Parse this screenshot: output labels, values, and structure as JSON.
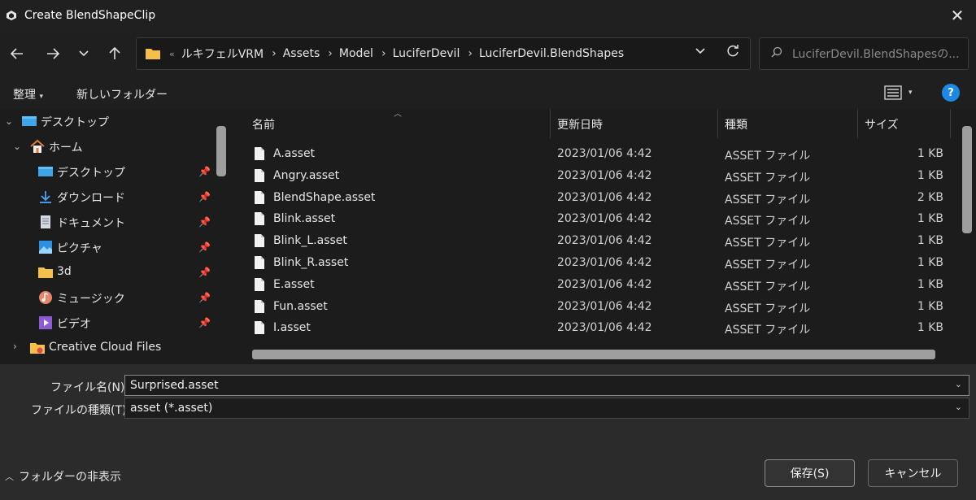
{
  "window": {
    "title": "Create BlendShapeClip"
  },
  "nav": {
    "back_icon": "arrow-left-icon",
    "forward_icon": "arrow-right-icon",
    "up_icon": "arrow-up-icon",
    "overflow": "«",
    "breadcrumbs": [
      "ルキフェルVRM",
      "Assets",
      "Model",
      "LuciferDevil",
      "LuciferDevil.BlendShapes"
    ],
    "search_placeholder": "LuciferDevil.BlendShapesの..."
  },
  "toolbar": {
    "organize_label": "整理",
    "new_folder_label": "新しいフォルダー",
    "help_label": "?"
  },
  "sidebar": {
    "items": [
      {
        "label": "デスクトップ",
        "icon": "desktop-icon",
        "pinned": false
      },
      {
        "label": "ホーム",
        "icon": "home-icon",
        "pinned": false
      },
      {
        "label": "デスクトップ",
        "icon": "desktop-icon",
        "pinned": true
      },
      {
        "label": "ダウンロード",
        "icon": "download-icon",
        "pinned": true
      },
      {
        "label": "ドキュメント",
        "icon": "document-icon",
        "pinned": true
      },
      {
        "label": "ピクチャ",
        "icon": "pictures-icon",
        "pinned": true
      },
      {
        "label": "3d",
        "icon": "folder-icon",
        "pinned": true
      },
      {
        "label": "ミュージック",
        "icon": "music-icon",
        "pinned": true
      },
      {
        "label": "ビデオ",
        "icon": "video-icon",
        "pinned": true
      },
      {
        "label": "Creative Cloud Files",
        "icon": "creative-cloud-folder-icon",
        "pinned": false
      }
    ]
  },
  "file_list": {
    "columns": {
      "name": "名前",
      "date": "更新日時",
      "type": "種類",
      "size": "サイズ"
    },
    "rows": [
      {
        "name": "A.asset",
        "date": "2023/01/06 4:42",
        "type": "ASSET ファイル",
        "size": "1 KB"
      },
      {
        "name": "Angry.asset",
        "date": "2023/01/06 4:42",
        "type": "ASSET ファイル",
        "size": "1 KB"
      },
      {
        "name": "BlendShape.asset",
        "date": "2023/01/06 4:42",
        "type": "ASSET ファイル",
        "size": "2 KB"
      },
      {
        "name": "Blink.asset",
        "date": "2023/01/06 4:42",
        "type": "ASSET ファイル",
        "size": "1 KB"
      },
      {
        "name": "Blink_L.asset",
        "date": "2023/01/06 4:42",
        "type": "ASSET ファイル",
        "size": "1 KB"
      },
      {
        "name": "Blink_R.asset",
        "date": "2023/01/06 4:42",
        "type": "ASSET ファイル",
        "size": "1 KB"
      },
      {
        "name": "E.asset",
        "date": "2023/01/06 4:42",
        "type": "ASSET ファイル",
        "size": "1 KB"
      },
      {
        "name": "Fun.asset",
        "date": "2023/01/06 4:42",
        "type": "ASSET ファイル",
        "size": "1 KB"
      },
      {
        "name": "I.asset",
        "date": "2023/01/06 4:42",
        "type": "ASSET ファイル",
        "size": "1 KB"
      }
    ]
  },
  "save_panel": {
    "filename_label": "ファイル名(N):",
    "filename_value": "Surprised.asset",
    "filetype_label": "ファイルの種類(T):",
    "filetype_value": "asset (*.asset)",
    "hide_folders_label": "フォルダーの非表示",
    "save_button": "保存(S)",
    "cancel_button": "キャンセル"
  },
  "colors": {
    "accent": "#1e88e5",
    "folder": "#f5c04a"
  }
}
